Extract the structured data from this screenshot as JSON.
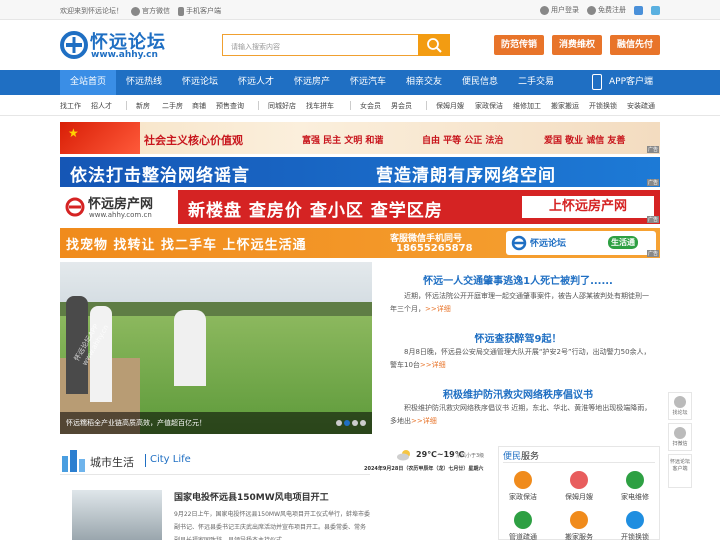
{
  "topbar": {
    "welcome": "欢迎来到怀远论坛！",
    "wechat": "官方微信",
    "mobile": "手机客户端",
    "login": "用户登录",
    "register": "免费注册"
  },
  "logo": {
    "name": "怀远论坛",
    "domain": "www.ahhy.cn"
  },
  "search": {
    "placeholder": "请输入搜索内容"
  },
  "header_buttons": [
    "防范传销",
    "消费维权",
    "融信先付"
  ],
  "nav": [
    "全站首页",
    "怀远热线",
    "怀远论坛",
    "怀远人才",
    "怀远房产",
    "怀远汽车",
    "相亲交友",
    "便民信息",
    "二手交易",
    "APP客户端"
  ],
  "subnav": [
    "找工作",
    "招人才",
    "新房",
    "二手房",
    "商铺",
    "预售查询",
    "同城好店",
    "找车拼车",
    "女会员",
    "男会员",
    "保姆月嫂",
    "家政保洁",
    "维修加工",
    "搬家搬运",
    "开锁换锁",
    "安装疏通"
  ],
  "banner1": {
    "title": "社会主义核心价值观",
    "values1": "富强 民主 文明 和谐",
    "values2": "自由 平等 公正 法治",
    "values3": "爱国 敬业 诚信 友善",
    "ad": "广告"
  },
  "banner2": {
    "left": "依法打击整治网络谣言",
    "right": "营造清朗有序网络空间",
    "ad": "广告"
  },
  "banner3": {
    "brand": "怀远房产网",
    "domain": "www.ahhy.com.cn",
    "slogan": "新楼盘 查房价 查小区 查学区房",
    "cta": "上怀远房产网",
    "ad": "广告"
  },
  "banner4": {
    "slogan": "找宠物 找转让 找二手车 上怀远生活通",
    "phone_label": "客服微信手机同号",
    "phone": "18655265878",
    "brand": "怀远论坛",
    "brand2": "生活通",
    "ad": "广告"
  },
  "slider": {
    "caption": "怀远糯稻全产业链高质高效，产值超百亿元！",
    "watermark": "怀远论坛APP\nwww.ahhy.cn"
  },
  "news": [
    {
      "title": "怀远一人交通肇事逃逸1人死亡被判了......",
      "body": "近期，怀远法院公开开庭审理一起交通肇事案件，被告人邵某被判处有期徒刑一年三个月，",
      "more": ">>详细"
    },
    {
      "title": "怀远查获醉驾9起！",
      "body": "8月8日晚，怀远县公安局交通管理大队开展“护安2号”行动，出动警力50余人，警车10台",
      "more": ">>详细"
    },
    {
      "title": "积极维护防汛救灾网络秩序倡议书",
      "body": "积极维护防汛救灾网络秩序倡议书 近期，东北、华北、黄淮等地出现极端降雨，多地出",
      "more": ">>详细"
    }
  ],
  "city": {
    "title_cn": "城市生活",
    "title_en": "City Life",
    "headline": "国家电投怀远县150MW风电项目开工",
    "text": "9月22日上午，国家电投怀远县150MW风电项目开工仪式举行，蚌埠市委副书记、怀远县委书记王庆武出席活动并宣布项目开工。县委常委、常务副县长福家国致辞，县领导杨杰主持仪式。"
  },
  "weather": {
    "temp": "29℃~19℃",
    "wind": "东风小于3级",
    "date": "2024年9月28日（农历甲辰年（龙）七月廿）星期六"
  },
  "bianmin": {
    "title": "便民",
    "title2": "服务",
    "items": [
      "家政保洁",
      "保姆月嫂",
      "家电维修",
      "管道疏通",
      "搬家服务",
      "开锁换锁"
    ]
  },
  "side": [
    "找论坛",
    "扫微信",
    "怀远论坛客户端"
  ],
  "colors": {
    "nav": "#1f6fc3",
    "accent": "#e8742a",
    "search": "#f39c12"
  }
}
